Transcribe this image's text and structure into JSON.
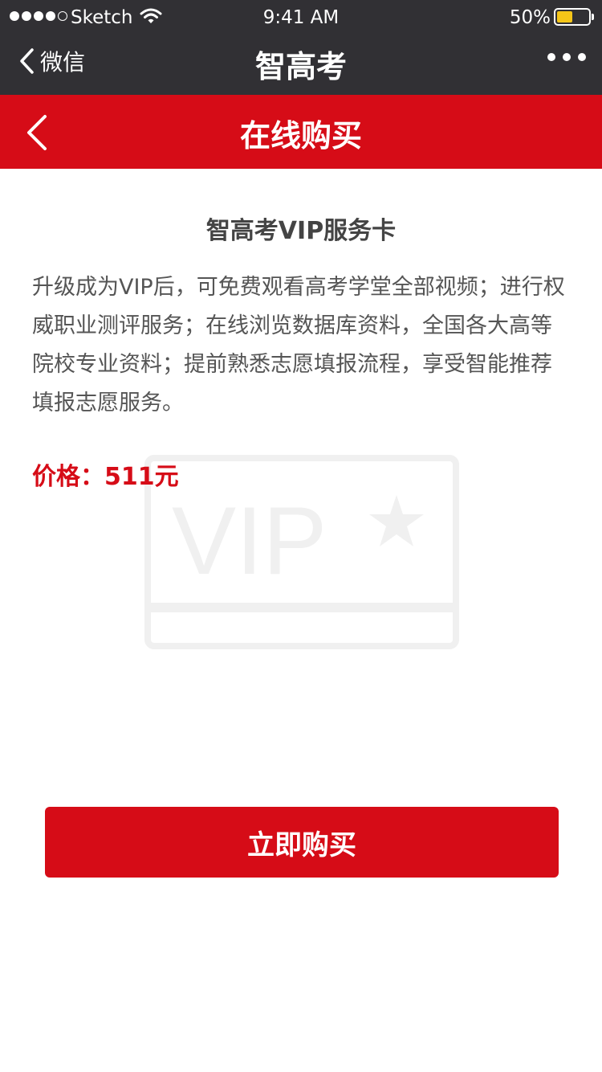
{
  "status_bar": {
    "carrier": "Sketch",
    "time": "9:41 AM",
    "battery_percent": "50%",
    "battery_level": 0.5
  },
  "wechat_nav": {
    "back_label": "微信",
    "title": "智高考"
  },
  "page_header": {
    "title": "在线购买"
  },
  "product": {
    "title": "智高考VIP服务卡",
    "description": "升级成为VIP后，可免费观看高考学堂全部视频；进行权威职业测评服务；在线浏览数据库资料，全国各大高等院校专业资料；提前熟悉志愿填报流程，享受智能推荐填报志愿服务。",
    "price_label": "价格：511元",
    "watermark_text": "VIP"
  },
  "actions": {
    "buy_label": "立即购买"
  },
  "colors": {
    "brand_red": "#d60c17",
    "nav_dark": "#313034",
    "battery_yellow": "#f5c518"
  }
}
